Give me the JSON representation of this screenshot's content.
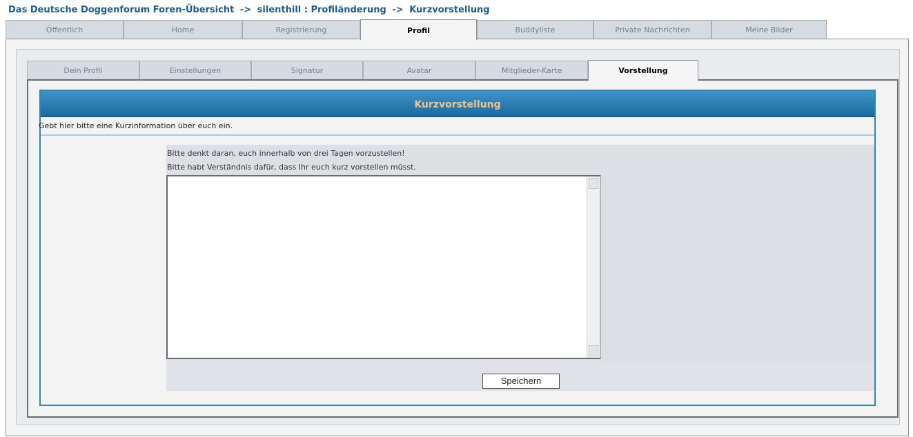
{
  "breadcrumb": {
    "forum": "Das Deutsche Doggenforum Foren-Übersicht",
    "sep1": "->",
    "user": "silenthill : Profiländerung",
    "sep2": "->",
    "page": "Kurzvorstellung"
  },
  "top_tabs": [
    {
      "label": "Öffentlich"
    },
    {
      "label": "Home"
    },
    {
      "label": "Registrierung"
    },
    {
      "label": "Profil",
      "active": true
    },
    {
      "label": "Buddyliste"
    },
    {
      "label": "Private Nachrichten"
    },
    {
      "label": "Meine Bilder"
    }
  ],
  "sub_tabs": [
    {
      "label": "Dein Profil"
    },
    {
      "label": "Einstellungen"
    },
    {
      "label": "Signatur"
    },
    {
      "label": "Avatar"
    },
    {
      "label": "Mitglieder-Karte"
    },
    {
      "label": "Vorstellung",
      "active": true
    }
  ],
  "form": {
    "title": "Kurzvorstellung",
    "description": "Gebt hier bitte eine Kurzinformation über euch ein.",
    "hint_1": "Bitte denkt daran, euch innerhalb von drei Tagen vorzustellen!",
    "hint_2": "Bitte habt Verständnis dafür, dass Ihr euch kurz vorstellen müsst.",
    "textarea_value": "",
    "save_label": "Speichern"
  }
}
